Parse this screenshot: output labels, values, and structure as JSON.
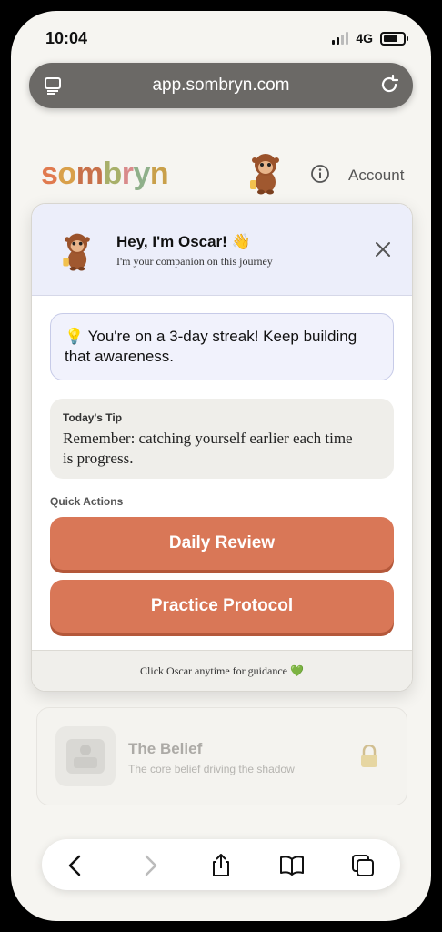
{
  "status_bar": {
    "time": "10:04",
    "network": "4G"
  },
  "browser": {
    "url": "app.sombryn.com"
  },
  "header": {
    "logo_letters": [
      "s",
      "o",
      "m",
      "b",
      "r",
      "y",
      "n"
    ],
    "account_label": "Account"
  },
  "companion": {
    "title": "Hey, I'm Oscar! 👋",
    "subtitle": "I'm your companion on this journey",
    "streak_text": "💡 You're on a 3-day streak! Keep building that awareness.",
    "tip_label": "Today's Tip",
    "tip_text": "Remember: catching yourself earlier each time is progress.",
    "quick_actions_label": "Quick Actions",
    "actions": [
      "Daily Review",
      "Practice Protocol"
    ],
    "footer": "Click Oscar anytime for guidance 💚"
  },
  "locked_card": {
    "title": "The Belief",
    "subtitle": "The core belief driving the shadow"
  },
  "colors": {
    "accent": "#d97757",
    "header_bg": "#eceefa",
    "background": "#f6f5f1"
  }
}
